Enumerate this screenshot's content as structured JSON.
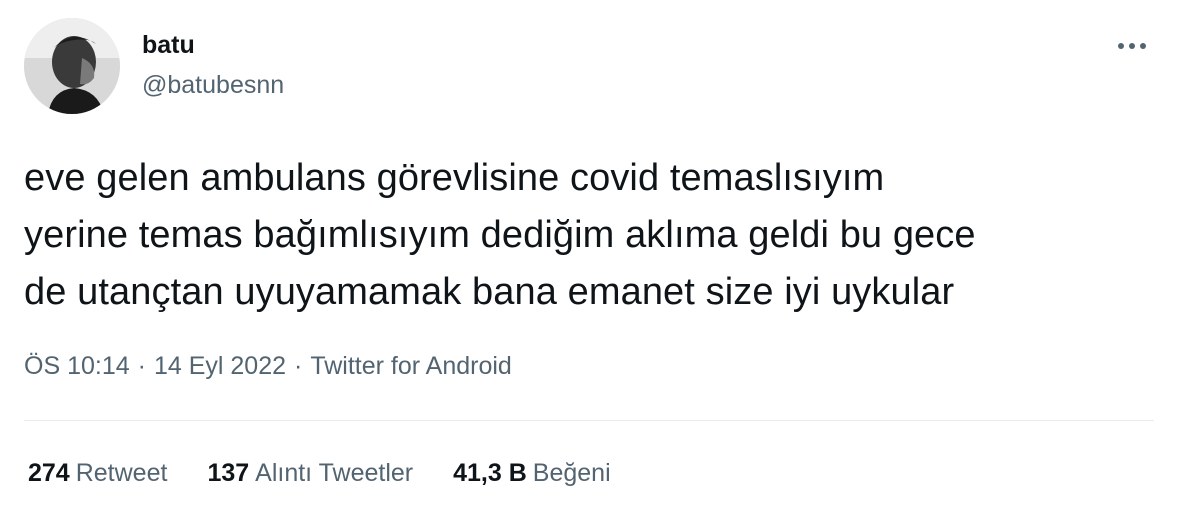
{
  "author": {
    "display_name": "batu",
    "handle": "@batubesnn",
    "avatar_icon": "profile-photo"
  },
  "more_icon": "ellipsis-icon",
  "tweet": {
    "lines": [
      "eve gelen ambulans görevlisine covid temaslısıyım",
      "yerine temas bağımlısıyım dediğim aklıma geldi bu gece",
      "de utançtan uyuyamamak bana emanet size iyi uykular"
    ]
  },
  "meta": {
    "time": "ÖS 10:14",
    "separator": "·",
    "date": "14 Eyl 2022",
    "source": "Twitter for Android"
  },
  "stats": {
    "retweets": {
      "count": "274",
      "label": "Retweet"
    },
    "quotes": {
      "count": "137",
      "label": "Alıntı Tweetler"
    },
    "likes": {
      "count": "41,3 B",
      "label": "Beğeni"
    }
  },
  "colors": {
    "text": "#0f1419",
    "secondary": "#536471",
    "divider": "#e7ecf0"
  }
}
